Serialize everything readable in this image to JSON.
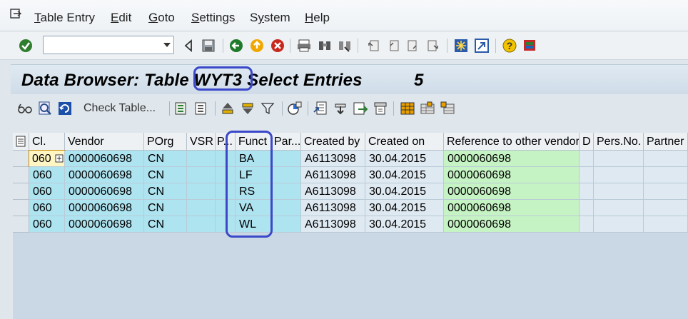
{
  "menubar": {
    "items": [
      {
        "label": "Table Entry",
        "u": "T"
      },
      {
        "label": "Edit",
        "u": "E"
      },
      {
        "label": "Goto",
        "u": "G"
      },
      {
        "label": "Settings",
        "u": "S"
      },
      {
        "label": "System",
        "u": "y"
      },
      {
        "label": "Help",
        "u": "H"
      }
    ]
  },
  "toolbar": {
    "command_value": "",
    "icons": [
      "enter-icon",
      "back-icon",
      "save-icon",
      "back-green-icon",
      "exit-icon",
      "cancel-icon",
      "print-icon",
      "find-icon",
      "find-next-icon",
      "first-page-icon",
      "prev-page-icon",
      "next-page-icon",
      "last-page-icon",
      "new-session-icon",
      "shortcut-icon",
      "help-icon",
      "customize-icon"
    ]
  },
  "title": {
    "prefix": "Data Browser: Table ",
    "table": "WYT3",
    "suffix": " Select Entries",
    "count": "5"
  },
  "app_toolbar": {
    "check_table_label": "Check Table..."
  },
  "table": {
    "headers": [
      "Cl.",
      "Vendor",
      "POrg",
      "VSR",
      "P...",
      "Funct",
      "Par...",
      "Created by",
      "Created on",
      "Reference to other vendor",
      "D",
      "Pers.No.",
      "Partner"
    ],
    "rows": [
      [
        "060",
        "0000060698",
        "CN",
        "",
        "",
        "BA",
        "",
        "A6113098",
        "30.04.2015",
        "0000060698",
        "",
        "",
        ""
      ],
      [
        "060",
        "0000060698",
        "CN",
        "",
        "",
        "LF",
        "",
        "A6113098",
        "30.04.2015",
        "0000060698",
        "",
        "",
        ""
      ],
      [
        "060",
        "0000060698",
        "CN",
        "",
        "",
        "RS",
        "",
        "A6113098",
        "30.04.2015",
        "0000060698",
        "",
        "",
        ""
      ],
      [
        "060",
        "0000060698",
        "CN",
        "",
        "",
        "VA",
        "",
        "A6113098",
        "30.04.2015",
        "0000060698",
        "",
        "",
        ""
      ],
      [
        "060",
        "0000060698",
        "CN",
        "",
        "",
        "WL",
        "",
        "A6113098",
        "30.04.2015",
        "0000060698",
        "",
        "",
        ""
      ]
    ]
  },
  "colors": {
    "key_cell": "#aee3f0",
    "reference_cell": "#c6f3c3",
    "highlight": "#3a48c9"
  }
}
